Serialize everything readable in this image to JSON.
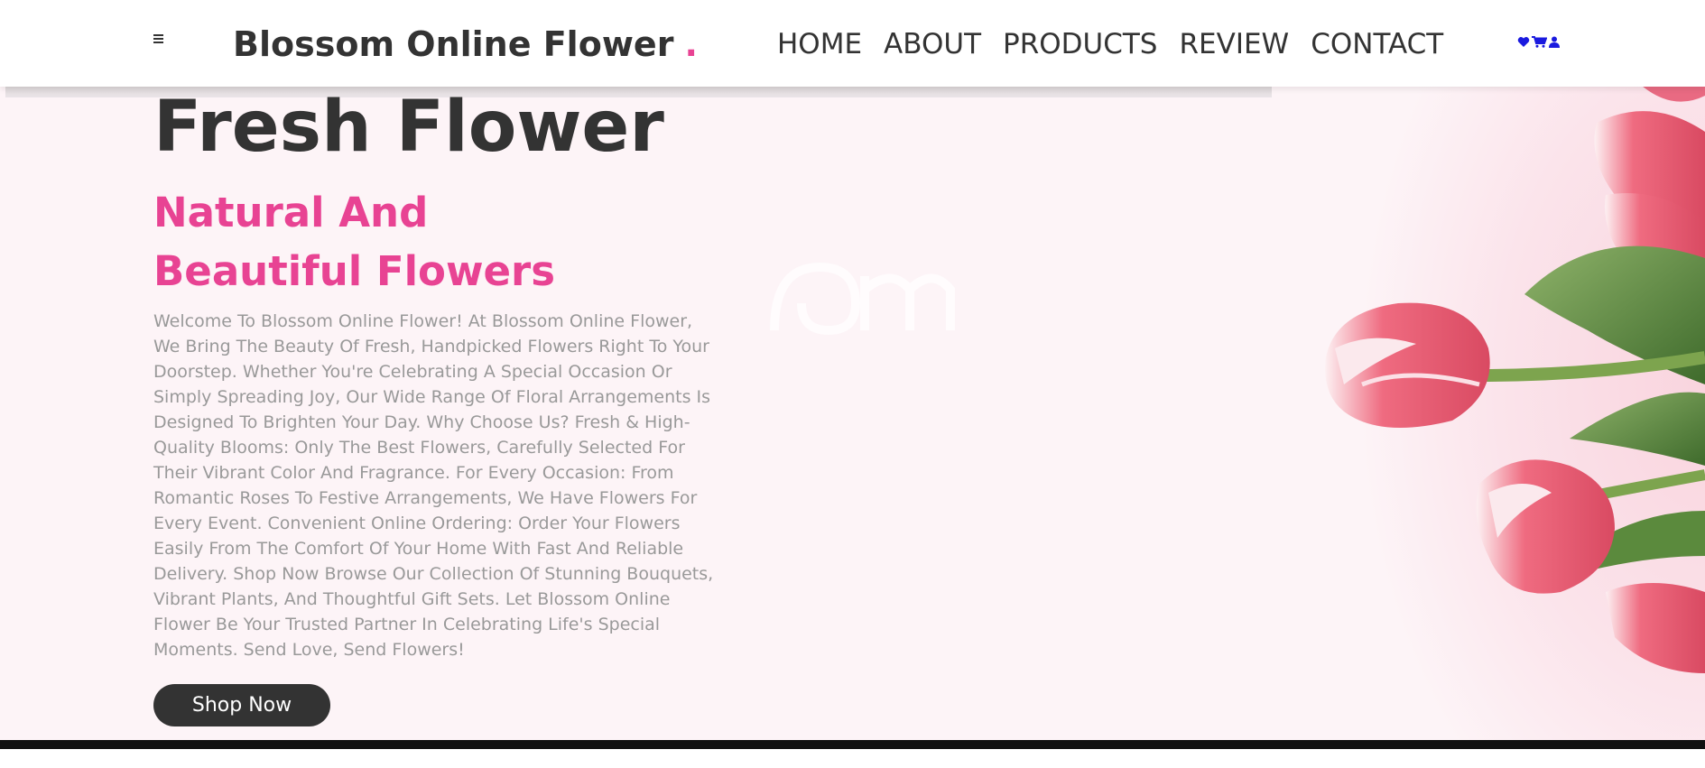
{
  "header": {
    "menu_icon": "hamburger-icon",
    "logo_text": "Blossom Online Flower",
    "logo_dot": ".",
    "nav": [
      {
        "label": "HOME"
      },
      {
        "label": "ABOUT"
      },
      {
        "label": "PRODUCTS"
      },
      {
        "label": "REVIEW"
      },
      {
        "label": "CONTACT"
      }
    ],
    "icons": [
      "heart-icon",
      "cart-icon",
      "user-icon"
    ]
  },
  "hero": {
    "title": "Fresh Flower",
    "subtitle": "Natural And Beautiful Flowers",
    "description": "Welcome To Blossom Online Flower! At Blossom Online Flower, We Bring The Beauty Of Fresh, Handpicked Flowers Right To Your Doorstep. Whether You're Celebrating A Special Occasion Or Simply Spreading Joy, Our Wide Range Of Floral Arrangements Is Designed To Brighten Your Day. Why Choose Us? Fresh & High-Quality Blooms: Only The Best Flowers, Carefully Selected For Their Vibrant Color And Fragrance. For Every Occasion: From Romantic Roses To Festive Arrangements, We Have Flowers For Every Event. Convenient Online Ordering: Order Your Flowers Easily From The Comfort Of Your Home With Fast And Reliable Delivery. Shop Now Browse Our Collection Of Stunning Bouquets, Vibrant Plants, And Thoughtful Gift Sets. Let Blossom Online Flower Be Your Trusted Partner In Celebrating Life's Special Moments. Send Love, Send Flowers!",
    "button_label": "Shop Now"
  },
  "colors": {
    "accent": "#e84393",
    "dark": "#333333",
    "hero_bg": "#fdf4f7",
    "icon_blue": "#1a1adf"
  }
}
